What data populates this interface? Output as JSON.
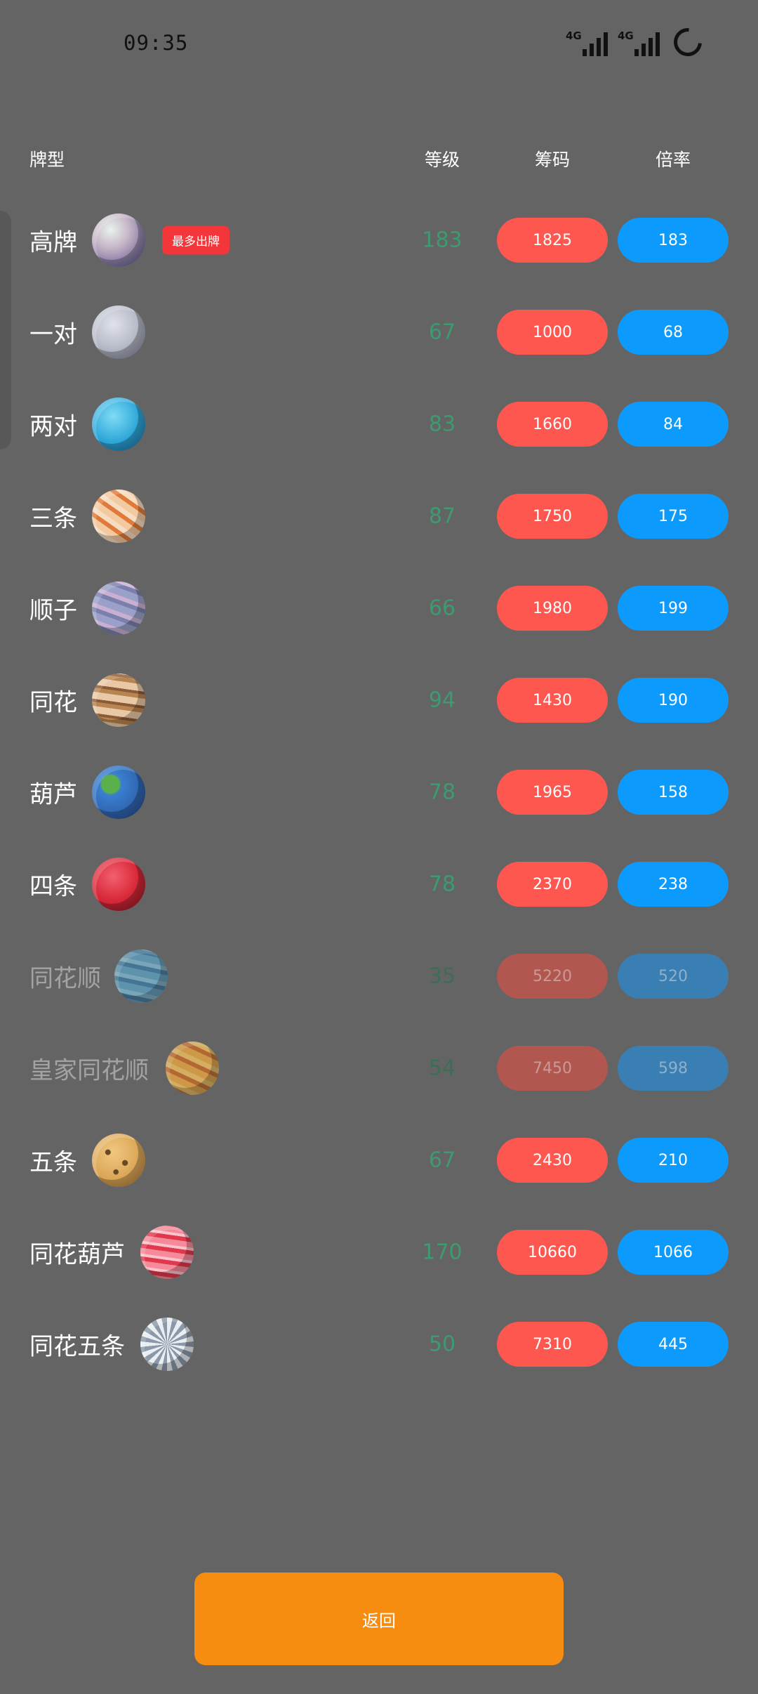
{
  "status": {
    "time": "09:35",
    "net1": "4G",
    "net2": "4G"
  },
  "header": {
    "type": "牌型",
    "level": "等级",
    "chips": "筹码",
    "rate": "倍率"
  },
  "badge": "最多出牌",
  "rows": [
    {
      "name": "高牌",
      "level": "183",
      "chips": "1825",
      "rate": "183",
      "dim": false,
      "planet": "pearl"
    },
    {
      "name": "一对",
      "level": "67",
      "chips": "1000",
      "rate": "68",
      "dim": false,
      "planet": "grey-moon"
    },
    {
      "name": "两对",
      "level": "83",
      "chips": "1660",
      "rate": "84",
      "dim": false,
      "planet": "blue-ringed"
    },
    {
      "name": "三条",
      "level": "87",
      "chips": "1750",
      "rate": "175",
      "dim": false,
      "planet": "orange-striped"
    },
    {
      "name": "顺子",
      "level": "66",
      "chips": "1980",
      "rate": "199",
      "dim": false,
      "planet": "lavender-ringed"
    },
    {
      "name": "同花",
      "level": "94",
      "chips": "1430",
      "rate": "190",
      "dim": false,
      "planet": "brown-striped"
    },
    {
      "name": "葫芦",
      "level": "78",
      "chips": "1965",
      "rate": "158",
      "dim": false,
      "planet": "earth"
    },
    {
      "name": "四条",
      "level": "78",
      "chips": "2370",
      "rate": "238",
      "dim": false,
      "planet": "red"
    },
    {
      "name": "同花顺",
      "level": "35",
      "chips": "5220",
      "rate": "520",
      "dim": true,
      "planet": "blue-striped"
    },
    {
      "name": "皇家同花顺",
      "level": "54",
      "chips": "7450",
      "rate": "598",
      "dim": true,
      "planet": "gold-sun"
    },
    {
      "name": "五条",
      "level": "67",
      "chips": "2430",
      "rate": "210",
      "dim": false,
      "planet": "cookie"
    },
    {
      "name": "同花葫芦",
      "level": "170",
      "chips": "10660",
      "rate": "1066",
      "dim": false,
      "planet": "pink-striped"
    },
    {
      "name": "同花五条",
      "level": "50",
      "chips": "7310",
      "rate": "445",
      "dim": false,
      "planet": "disco"
    }
  ],
  "back_label": "返回",
  "colors": {
    "background": "#646464",
    "chips": "#fe5750",
    "rate": "#0d9afd",
    "level": "#3d9b70",
    "back": "#f68c10",
    "badge": "#f2363a"
  }
}
